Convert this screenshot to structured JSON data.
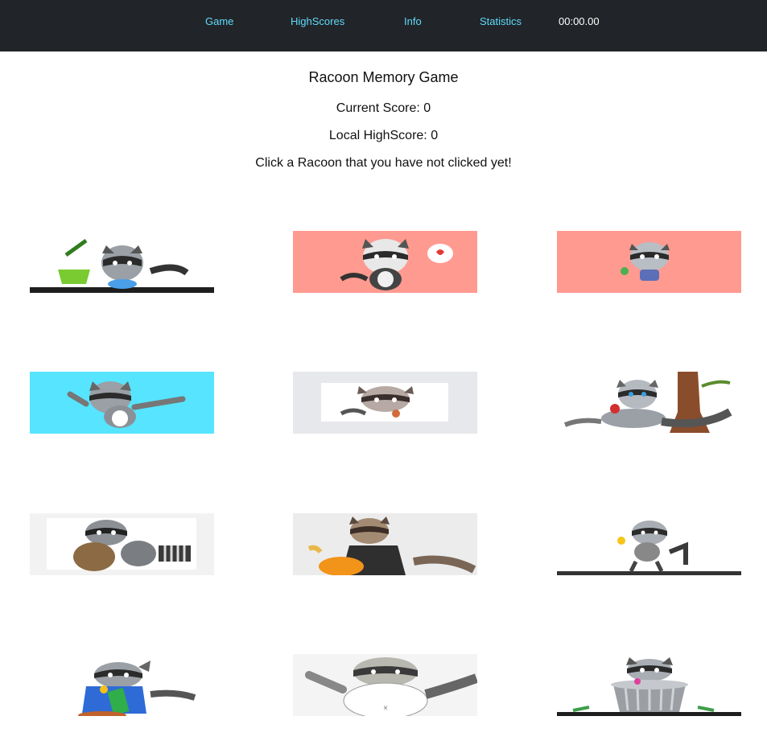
{
  "nav": {
    "links": [
      "Game",
      "HighScores",
      "Info",
      "Statistics"
    ],
    "timer": "00:00.00",
    "link_color": "#61dafb",
    "background": "#212529"
  },
  "header": {
    "title": "Racoon Memory Game",
    "current_score": "Current Score: 0",
    "local_highscore": "Local HighScore: 0",
    "instruction": "Click a Racoon that you have not clicked yet!"
  },
  "cards": [
    {
      "icon": "raccoon-cleaning-icon",
      "bg": "#ffffff"
    },
    {
      "icon": "raccoon-heart-icon",
      "bg": "#ff9a90"
    },
    {
      "icon": "raccoon-small-icon",
      "bg": "#ff9a90"
    },
    {
      "icon": "raccoon-dabbing-icon",
      "bg": "#56e4ff"
    },
    {
      "icon": "raccoon-sticker-icon",
      "bg": "#e6e8ec"
    },
    {
      "icon": "raccoon-apple-icon",
      "bg": "#ffffff"
    },
    {
      "icon": "raccoon-money-bag-icon",
      "bg": "#f2f2f2"
    },
    {
      "icon": "raccoon-honey-icon",
      "bg": "#ececec"
    },
    {
      "icon": "raccoon-running-icon",
      "bg": "#ffffff"
    },
    {
      "icon": "raccoon-book-icon",
      "bg": "#ffffff"
    },
    {
      "icon": "raccoon-fluffy-icon",
      "bg": "#f4f4f4"
    },
    {
      "icon": "raccoon-trash-can-icon",
      "bg": "#ffffff"
    }
  ]
}
